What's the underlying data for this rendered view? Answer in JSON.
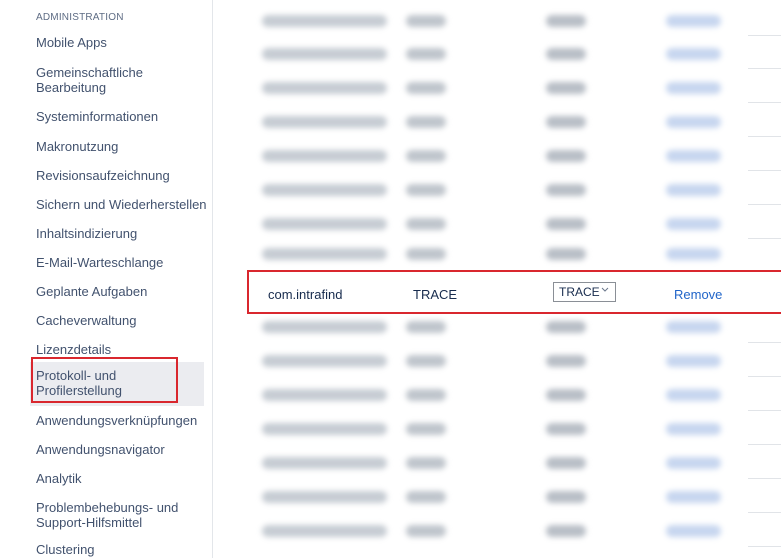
{
  "sidebar": {
    "heading": "ADMINISTRATION",
    "items": [
      {
        "label": "Mobile Apps"
      },
      {
        "label": "Gemeinschaftliche Bearbeitung"
      },
      {
        "label": "Systeminformationen"
      },
      {
        "label": "Makronutzung"
      },
      {
        "label": "Revisionsaufzeichnung"
      },
      {
        "label": "Sichern und Wiederherstellen"
      },
      {
        "label": "Inhaltsindizierung"
      },
      {
        "label": "E-Mail-Warteschlange"
      },
      {
        "label": "Geplante Aufgaben"
      },
      {
        "label": "Cacheverwaltung"
      },
      {
        "label": "Lizenzdetails"
      },
      {
        "label": "Protokoll- und Profilerstellung"
      },
      {
        "label": "Anwendungsverknüpfungen"
      },
      {
        "label": "Anwendungsnavigator"
      },
      {
        "label": "Analytik"
      },
      {
        "label": "Problembehebungs- und Support-Hilfsmittel"
      },
      {
        "label": "Clustering"
      }
    ],
    "selected_index": 11
  },
  "logger_row": {
    "class_name": "com.intrafind",
    "level": "TRACE",
    "select_value": "TRACE",
    "action_label": "Remove"
  },
  "colors": {
    "highlight": "#d9272e",
    "link": "#2165c9",
    "nav_text": "#42526e"
  }
}
